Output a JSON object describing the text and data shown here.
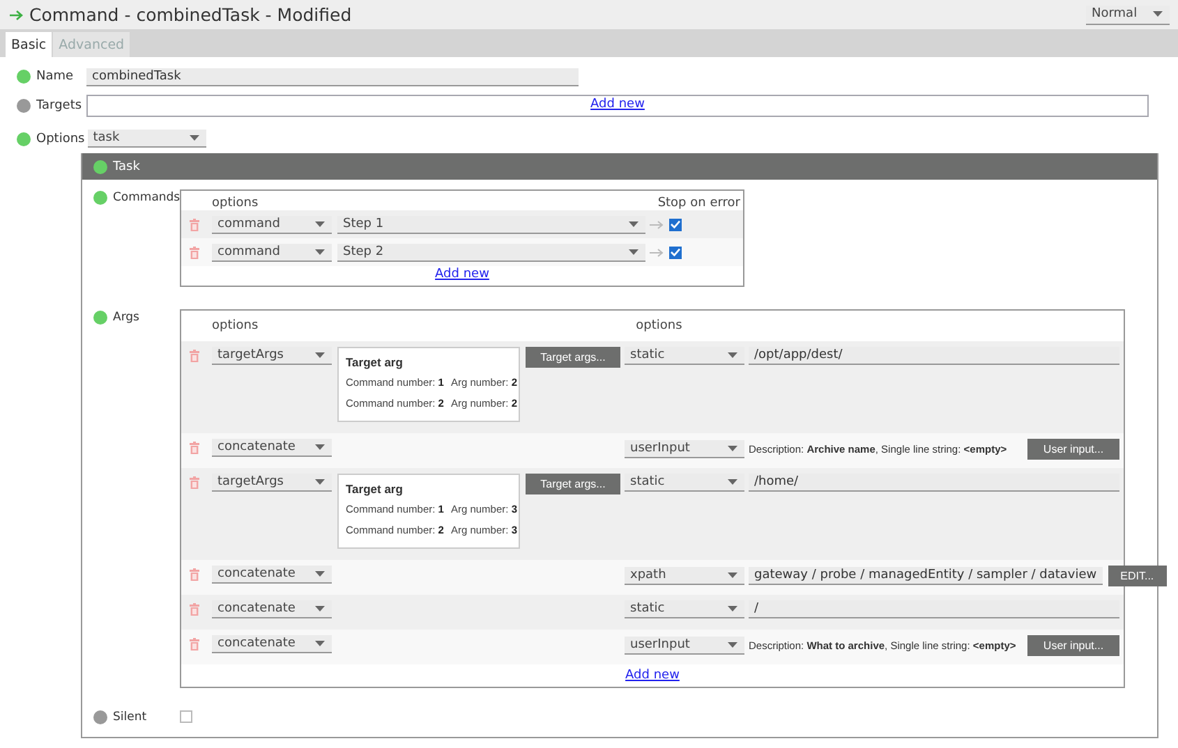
{
  "window": {
    "title": "Command - combinedTask - Modified",
    "mode": "Normal"
  },
  "tabs": [
    {
      "label": "Basic",
      "selected": true
    },
    {
      "label": "Advanced",
      "selected": false
    }
  ],
  "name": {
    "label": "Name",
    "color": "#66d066",
    "value": "combinedTask"
  },
  "targets": {
    "label": "Targets",
    "color": "#999999",
    "add_link": "Add new"
  },
  "options": {
    "label": "Options",
    "color": "#66d066",
    "value": "task"
  },
  "task": {
    "title": "Task",
    "color": "#66d066",
    "commands": {
      "label": "Commands",
      "color": "#66d066",
      "columns": [
        "options",
        "Stop on error"
      ],
      "add_link": "Add new",
      "rows": [
        {
          "type": "command",
          "step": "Step 1",
          "stop_on_error": true
        },
        {
          "type": "command",
          "step": "Step 2",
          "stop_on_error": true
        }
      ]
    },
    "args": {
      "label": "Args",
      "color": "#66d066",
      "columns": [
        "options",
        "options"
      ],
      "add_link": "Add new",
      "rows": [
        {
          "kind": "targetArgs",
          "select": "targetArgs",
          "target": {
            "title": "Target arg",
            "lines": [
              {
                "command": "Command number: **1**",
                "arg": "Arg number: **2**"
              },
              {
                "command": "Command number: **2**",
                "arg": "Arg number: **2**"
              }
            ]
          },
          "button": "Target args...",
          "source": {
            "kind": "static",
            "select": "static",
            "value": "/opt/app/dest/"
          }
        },
        {
          "kind": "concatenate",
          "select": "concatenate",
          "source": {
            "kind": "userInput",
            "select": "userInput",
            "description": "Description: **Archive name**, Single line string: **<empty>**",
            "button": "User input..."
          }
        },
        {
          "kind": "targetArgs",
          "select": "targetArgs",
          "target": {
            "title": "Target arg",
            "lines": [
              {
                "command": "Command number: **1**",
                "arg": "Arg number: **3**"
              },
              {
                "command": "Command number: **2**",
                "arg": "Arg number: **3**"
              }
            ]
          },
          "button": "Target args...",
          "source": {
            "kind": "static",
            "select": "static",
            "value": "/home/"
          }
        },
        {
          "kind": "concatenate",
          "select": "concatenate",
          "source": {
            "kind": "xpath",
            "select": "xpath",
            "value": "gateway / probe / managedEntity / sampler / dataview",
            "button": "EDIT..."
          }
        },
        {
          "kind": "concatenate",
          "select": "concatenate",
          "source": {
            "kind": "static",
            "select": "static",
            "value": "/"
          }
        },
        {
          "kind": "concatenate",
          "select": "concatenate",
          "source": {
            "kind": "userInput",
            "select": "userInput",
            "description": "Description: **What to archive**, Single line string: **<empty>**",
            "button": "User input..."
          }
        }
      ]
    },
    "silent": {
      "label": "Silent",
      "color": "#999999",
      "checked": false
    }
  }
}
